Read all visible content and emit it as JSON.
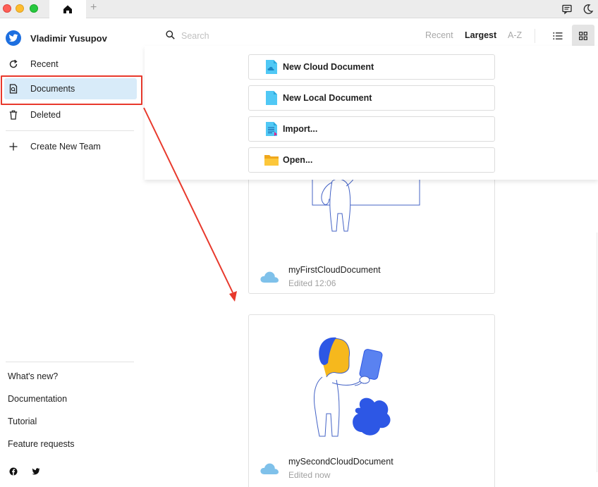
{
  "window": {
    "tabs": [
      {
        "icon": "home-icon"
      },
      {
        "label": "+"
      }
    ],
    "right_icons": [
      "feedback-icon",
      "moon-icon"
    ]
  },
  "sidebar": {
    "user_name": "Vladimir Yusupov",
    "items": [
      {
        "label": "Recent",
        "icon": "refresh-icon"
      },
      {
        "label": "Documents",
        "icon": "document-icon",
        "active": true
      },
      {
        "label": "Deleted",
        "icon": "trash-icon"
      },
      {
        "label": "Create New Team",
        "icon": "plus-icon"
      }
    ],
    "footer": [
      "What's new?",
      "Documentation",
      "Tutorial",
      "Feature requests"
    ],
    "social": [
      "facebook-icon",
      "twitter-icon"
    ]
  },
  "search": {
    "placeholder": "Search"
  },
  "sort": {
    "options": [
      "Recent",
      "Largest",
      "A-Z"
    ],
    "active": "Largest"
  },
  "view": {
    "options": [
      "list-view-icon",
      "grid-view-icon"
    ],
    "active": "grid-view-icon"
  },
  "menu": {
    "new_cloud": "New Cloud Document",
    "new_local": "New Local Document",
    "import": "Import...",
    "open": "Open..."
  },
  "documents": [
    {
      "name": "myFirstCloudDocument",
      "edited": "Edited 12:06"
    },
    {
      "name": "mySecondCloudDocument",
      "edited": "Edited now"
    }
  ],
  "colors": {
    "accent": "#1d6fe0",
    "active_bg": "#d8ebf9",
    "annotation": "#e8392c"
  }
}
